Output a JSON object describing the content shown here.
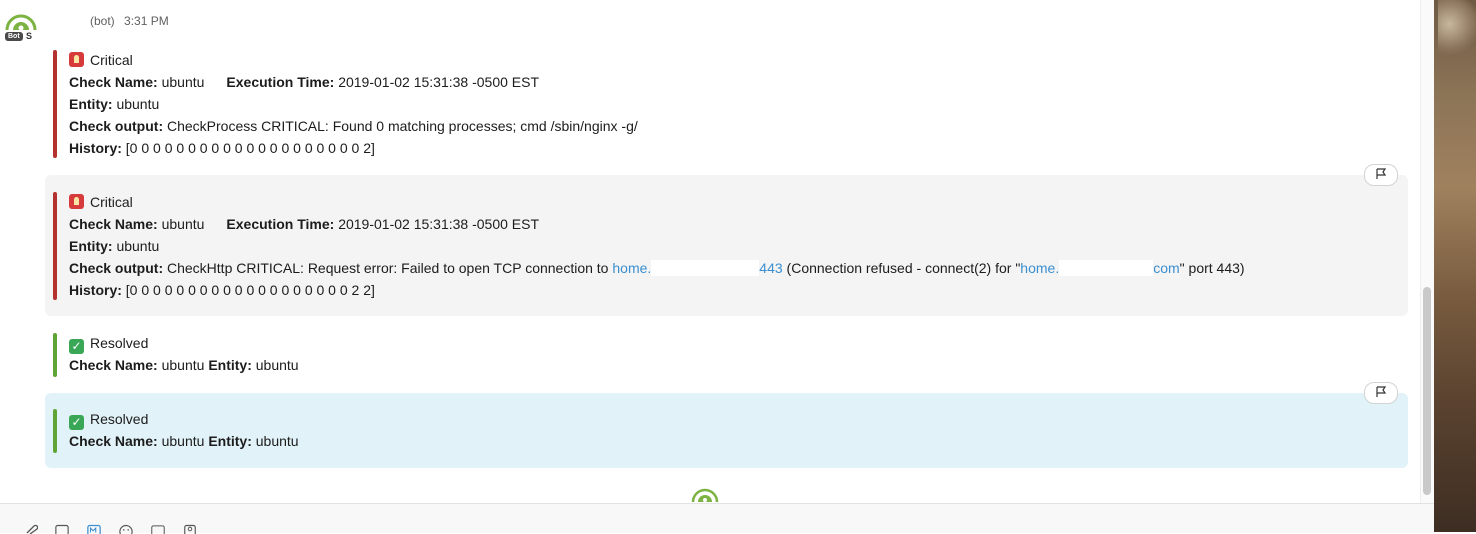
{
  "header": {
    "sender": "(bot)",
    "time": "3:31 PM",
    "badge": "Bot",
    "badge_suffix": "S"
  },
  "colors": {
    "critical": "#b3312f",
    "resolved": "#5fa536",
    "link": "#3a8fd0",
    "highlight": "#e1f3f8"
  },
  "alerts": [
    {
      "status": "Critical",
      "check_name_label": "Check Name:",
      "check_name": "ubuntu",
      "exec_label": "Execution Time:",
      "exec_time": "2019-01-02 15:31:38 -0500 EST",
      "entity_label": "Entity:",
      "entity": "ubuntu",
      "output_label": "Check output:",
      "output": "CheckProcess CRITICAL: Found 0 matching processes; cmd /sbin/nginx -g/",
      "history_label": "History:",
      "history": "[0 0 0 0 0 0 0 0 0 0 0 0 0 0 0 0 0 0 0 0 2]"
    },
    {
      "status": "Critical",
      "check_name_label": "Check Name:",
      "check_name": "ubuntu",
      "exec_label": "Execution Time:",
      "exec_time": "2019-01-02 15:31:38 -0500 EST",
      "entity_label": "Entity:",
      "entity": "ubuntu",
      "output_label": "Check output:",
      "output_prefix": "CheckHttp CRITICAL: Request error: Failed to open TCP connection to ",
      "output_link1_start": "home.",
      "output_link1_end": "443",
      "output_mid": " (Connection refused - connect(2) for \"",
      "output_link2_start": "home.",
      "output_link2_end": "com",
      "output_suffix": "\" port 443)",
      "history_label": "History:",
      "history": "[0 0 0 0 0 0 0 0 0 0 0 0 0 0 0 0 0 0 0 2 2]"
    },
    {
      "status": "Resolved",
      "check_name_label": "Check Name:",
      "check_name": "ubuntu",
      "entity_label": "Entity:",
      "entity": "ubuntu"
    },
    {
      "status": "Resolved",
      "check_name_label": "Check Name:",
      "check_name": "ubuntu",
      "entity_label": "Entity:",
      "entity": "ubuntu"
    }
  ],
  "icons": {
    "flag": "flag-icon",
    "avatar": "bot-avatar-icon"
  }
}
